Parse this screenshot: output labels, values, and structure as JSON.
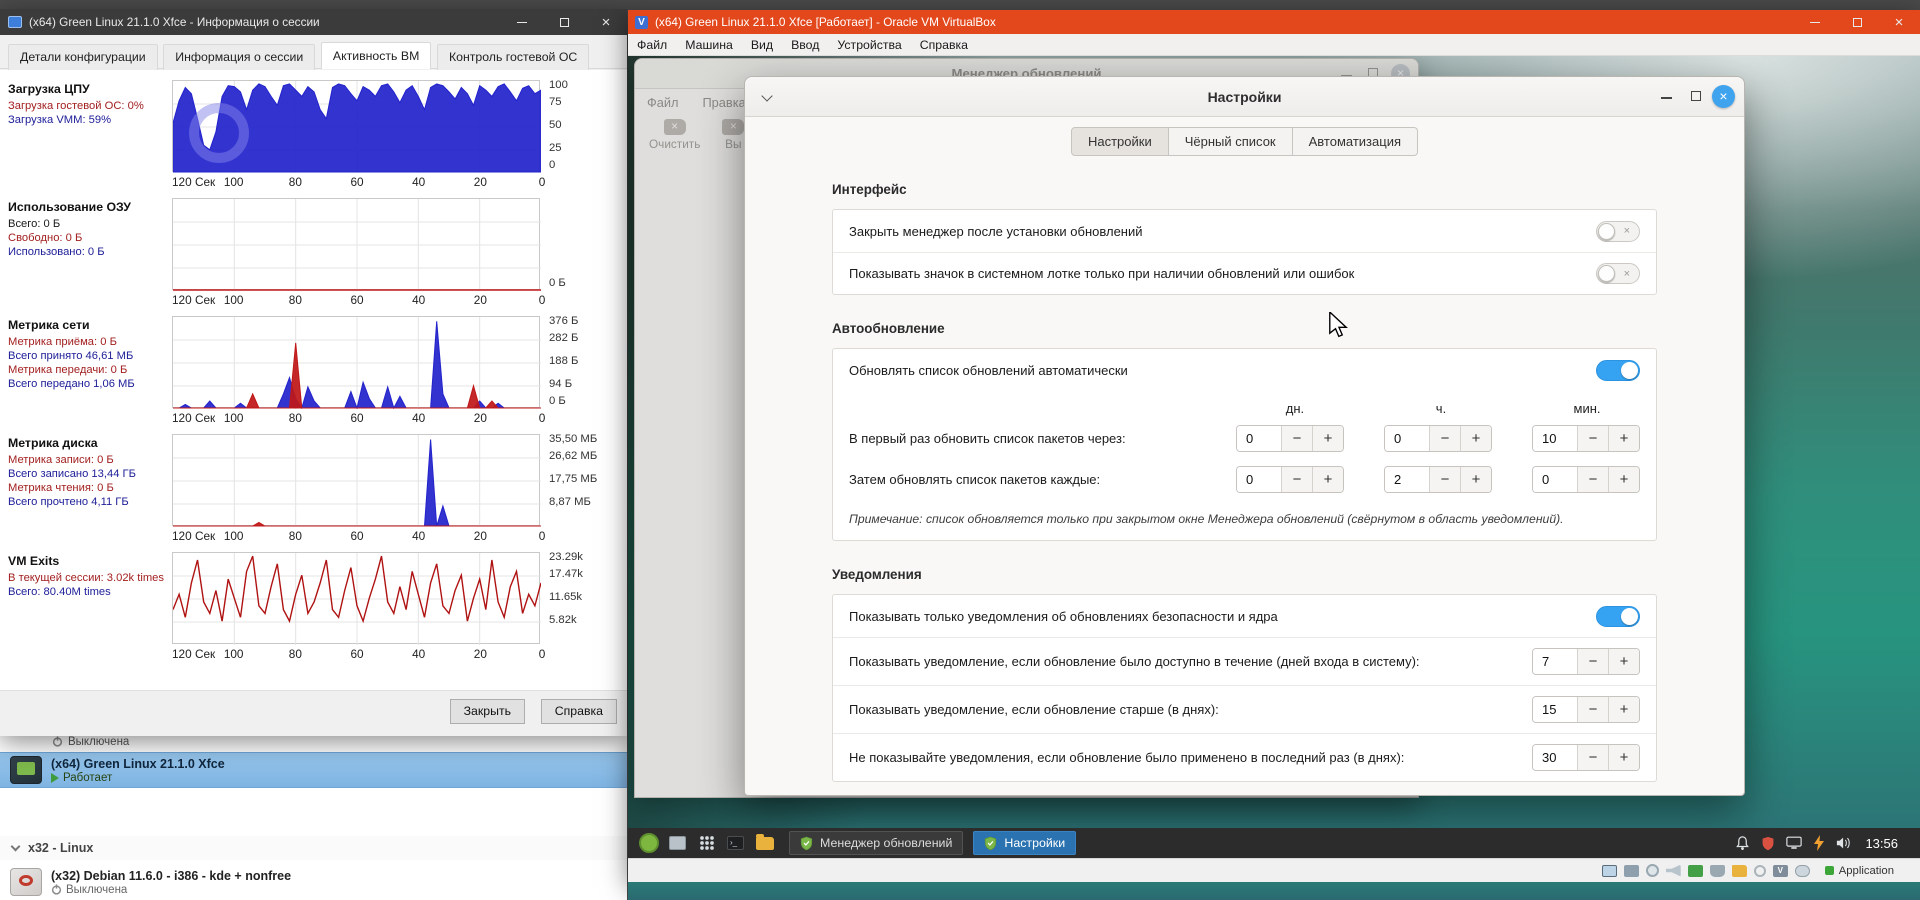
{
  "colors": {
    "accent_blue": "#36a3f2",
    "vbox_titlebar": "#e2481c",
    "panel_active_button": "#2a72b0",
    "list_selection": "#8abde8",
    "chart_blue": "#2323cc",
    "chart_red": "#c01818"
  },
  "host": {
    "session": {
      "title": "(x64) Green Linux 21.1.0 Xfce - Информация о сессии",
      "tabs": [
        "Детали конфигурации",
        "Информация о сессии",
        "Активность ВМ",
        "Контроль гостевой ОС"
      ],
      "active_tab": "Активность ВМ",
      "close_label": "Закрыть",
      "help_label": "Справка"
    },
    "list": {
      "partial_state": "Выключена",
      "selected": {
        "title": "(x64) Green Linux 21.1.0 Xfce",
        "state": "Работает"
      },
      "group_label": "x32 - Linux",
      "debian": {
        "title": "(x32) Debian 11.6.0 - i386 - kde + nonfree",
        "state": "Выключена"
      }
    }
  },
  "vbox": {
    "title": "(x64) Green Linux 21.1.0 Xfce [Работает] - Oracle VM VirtualBox",
    "menu": [
      "Файл",
      "Машина",
      "Вид",
      "Ввод",
      "Устройства",
      "Справка"
    ],
    "status": {
      "app_label": "Application"
    }
  },
  "mint": {
    "manager": {
      "title": "Менеджер обновлений",
      "menu": [
        "Файл",
        "Правка"
      ],
      "toolbar": {
        "clear": "Очистить",
        "partial": "Вы"
      }
    },
    "dialog": {
      "title": "Настройки",
      "tabs": [
        "Настройки",
        "Чёрный список",
        "Автоматизация"
      ],
      "interface": {
        "title": "Интерфейс",
        "rows": [
          "Закрыть менеджер после установки обновлений",
          "Показывать значок в системном лотке только при наличии обновлений или ошибок"
        ]
      },
      "auto": {
        "title": "Автообновление",
        "toggle_label": "Обновлять список обновлений автоматически",
        "col_headers": [
          "дн.",
          "ч.",
          "мин."
        ],
        "rows": [
          {
            "label": "В первый раз обновить список пакетов через:",
            "values": [
              "0",
              "0",
              "10"
            ]
          },
          {
            "label": "Затем обновлять список пакетов каждые:",
            "values": [
              "0",
              "2",
              "0"
            ]
          }
        ],
        "note": "Примечание: список обновляется только при закрытом окне Менеджера обновлений (свёрнутом в область уведомлений)."
      },
      "notifications": {
        "title": "Уведомления",
        "toggle_label": "Показывать только уведомления об обновлениях безопасности и ядра",
        "rows": [
          {
            "label": "Показывать уведомление, если обновление было доступно в течение (дней входа в систему):",
            "value": "7"
          },
          {
            "label": "Показывать уведомление, если обновление старше (в днях):",
            "value": "15"
          },
          {
            "label": "Не показывайте уведомления, если обновление было применено в последний раз (в днях):",
            "value": "30"
          }
        ]
      }
    },
    "panel": {
      "windows": [
        {
          "label": "Менеджер обновлений",
          "active": false
        },
        {
          "label": "Настройки",
          "active": true
        }
      ],
      "clock": "13:56"
    }
  },
  "chart_data": [
    {
      "id": "cpu",
      "type": "area",
      "title": "Загрузка ЦПУ",
      "ymax": 100,
      "watermark": true,
      "legend": [
        {
          "text": "Загрузка гостевой ОС: 0%",
          "color": "#a32020"
        },
        {
          "text": "Загрузка VMM: 59%",
          "color": "#20209a"
        }
      ],
      "ylabels": [
        {
          "t": "100",
          "f": 0
        },
        {
          "t": "75",
          "f": 0.25
        },
        {
          "t": "50",
          "f": 0.5
        },
        {
          "t": "25",
          "f": 0.75
        },
        {
          "t": "0",
          "f": 1
        }
      ],
      "xlabels": [
        "120 Сек",
        "100",
        "80",
        "60",
        "40",
        "20",
        "0"
      ],
      "series": [
        {
          "name": "Загрузка VMM",
          "color": "#2323cc",
          "fill": true,
          "values": [
            55,
            80,
            95,
            88,
            60,
            30,
            25,
            45,
            85,
            97,
            96,
            90,
            70,
            92,
            99,
            96,
            85,
            75,
            97,
            99,
            92,
            85,
            96,
            90,
            70,
            60,
            95,
            99,
            97,
            88,
            80,
            96,
            92,
            85,
            97,
            99,
            90,
            78,
            92,
            97,
            85,
            70,
            95,
            99,
            97,
            90,
            82,
            95,
            88,
            75,
            97,
            92,
            85,
            96,
            99,
            90,
            80,
            94,
            97,
            88,
            92
          ]
        }
      ]
    },
    {
      "id": "ram",
      "type": "line",
      "title": "Использование ОЗУ",
      "ymax": 100,
      "watermark": false,
      "legend": [
        {
          "text": "Всего: 0 Б",
          "color": "#1a1a1a"
        },
        {
          "text": "Свободно: 0 Б",
          "color": "#a32020"
        },
        {
          "text": "Использовано: 0 Б",
          "color": "#20209a"
        }
      ],
      "ylabels": [
        {
          "t": "0 Б",
          "f": 1
        }
      ],
      "xlabels": [
        "120 Сек",
        "100",
        "80",
        "60",
        "40",
        "20",
        "0"
      ],
      "series": [
        {
          "name": "Свободно",
          "color": "#c01818",
          "fill": false,
          "values": [
            0,
            0
          ]
        }
      ]
    },
    {
      "id": "net",
      "type": "line",
      "title": "Метрика сети",
      "ymax": 380,
      "watermark": false,
      "legend": [
        {
          "text": "Метрика приёма: 0 Б",
          "color": "#a32020"
        },
        {
          "text": "Всего принято 46,61 МБ",
          "color": "#20209a"
        },
        {
          "text": "Метрика передачи: 0 Б",
          "color": "#a32020"
        },
        {
          "text": "Всего передано 1,06 МБ",
          "color": "#20209a"
        }
      ],
      "ylabels": [
        {
          "t": "376 Б",
          "f": 0
        },
        {
          "t": "282 Б",
          "f": 0.25
        },
        {
          "t": "188 Б",
          "f": 0.5
        },
        {
          "t": "94 Б",
          "f": 0.75
        },
        {
          "t": "0 Б",
          "f": 1
        }
      ],
      "xlabels": [
        "120 Сек",
        "100",
        "80",
        "60",
        "40",
        "20",
        "0"
      ],
      "series": [
        {
          "name": "Приём",
          "color": "#2323cc",
          "fill": true,
          "values": [
            0,
            0,
            15,
            0,
            0,
            0,
            30,
            0,
            0,
            0,
            0,
            20,
            0,
            0,
            0,
            0,
            0,
            0,
            60,
            130,
            40,
            0,
            90,
            30,
            0,
            0,
            0,
            0,
            0,
            70,
            0,
            110,
            40,
            0,
            0,
            90,
            0,
            50,
            0,
            0,
            0,
            0,
            0,
            370,
            60,
            0,
            0,
            0,
            0,
            0,
            30,
            0,
            0,
            20,
            0,
            0,
            0,
            0,
            0,
            0,
            0
          ]
        },
        {
          "name": "Передача",
          "color": "#c01818",
          "fill": true,
          "values": [
            0,
            0,
            0,
            0,
            0,
            0,
            0,
            0,
            0,
            0,
            0,
            0,
            0,
            60,
            0,
            0,
            0,
            0,
            0,
            0,
            278,
            0,
            0,
            0,
            0,
            0,
            0,
            0,
            0,
            0,
            0,
            0,
            0,
            0,
            0,
            0,
            0,
            0,
            0,
            0,
            0,
            0,
            0,
            0,
            0,
            0,
            0,
            0,
            0,
            95,
            0,
            0,
            30,
            0,
            0,
            0,
            0,
            0,
            0,
            0,
            0
          ]
        }
      ]
    },
    {
      "id": "disk",
      "type": "line",
      "title": "Метрика диска",
      "ymax": 35.5,
      "watermark": false,
      "legend": [
        {
          "text": "Метрика записи: 0 Б",
          "color": "#a32020"
        },
        {
          "text": "Всего записано 13,44 ГБ",
          "color": "#20209a"
        },
        {
          "text": "Метрика чтения: 0 Б",
          "color": "#a32020"
        },
        {
          "text": "Всего прочтено 4,11 ГБ",
          "color": "#20209a"
        }
      ],
      "ylabels": [
        {
          "t": "35,50 МБ",
          "f": 0
        },
        {
          "t": "26,62 МБ",
          "f": 0.25
        },
        {
          "t": "17,75 МБ",
          "f": 0.5
        },
        {
          "t": "8,87 МБ",
          "f": 0.75
        }
      ],
      "xlabels": [
        "120 Сек",
        "100",
        "80",
        "60",
        "40",
        "20",
        "0"
      ],
      "series": [
        {
          "name": "Запись",
          "color": "#2323cc",
          "fill": true,
          "values": [
            0,
            0,
            0,
            0,
            0,
            0,
            0,
            0,
            0,
            0,
            0,
            0,
            0,
            0,
            0,
            0,
            0,
            0,
            0,
            0,
            0,
            0,
            0,
            0,
            0,
            0,
            0,
            0,
            0,
            0,
            0,
            0,
            0,
            0,
            0,
            0,
            0,
            0,
            0,
            0,
            0,
            0,
            34.5,
            0,
            8,
            0,
            0,
            0,
            0,
            0,
            0,
            0,
            0,
            0,
            0,
            0,
            0,
            0,
            0,
            0,
            0
          ]
        },
        {
          "name": "Чтение",
          "color": "#c01818",
          "fill": true,
          "values": [
            0,
            0,
            0,
            0,
            0,
            0,
            0,
            0,
            0,
            0,
            0,
            0,
            0,
            0,
            1.4,
            0,
            0,
            0,
            0,
            0,
            0,
            0,
            0,
            0,
            0,
            0,
            0,
            0,
            0,
            0,
            0,
            0,
            0,
            0,
            0,
            0,
            0,
            0,
            0,
            0,
            0,
            0,
            0,
            0,
            0,
            0,
            0,
            0,
            0,
            0,
            0,
            0,
            0,
            0,
            0,
            0,
            0,
            0,
            0,
            0,
            0
          ]
        }
      ]
    },
    {
      "id": "vmexits",
      "type": "line",
      "title": "VM Exits",
      "ymax": 23.3,
      "watermark": false,
      "legend": [
        {
          "text": "В текущей сессии: 3.02k times",
          "color": "#a32020"
        },
        {
          "text": "Всего: 80.40M times",
          "color": "#20209a"
        }
      ],
      "ylabels": [
        {
          "t": "23.29k",
          "f": 0
        },
        {
          "t": "17.47k",
          "f": 0.25
        },
        {
          "t": "11.65k",
          "f": 0.5
        },
        {
          "t": "5.82k",
          "f": 0.75
        }
      ],
      "xlabels": [
        "120 Сек",
        "100",
        "80",
        "60",
        "40",
        "20",
        "0"
      ],
      "series": [
        {
          "name": "VM Exits",
          "color": "#b01212",
          "fill": false,
          "values": [
            9,
            13,
            7,
            16,
            22,
            11,
            8,
            14,
            6,
            17,
            12,
            7,
            19,
            23,
            10,
            8,
            15,
            21,
            9,
            6,
            13,
            18,
            8,
            11,
            16,
            22,
            9,
            7,
            14,
            20,
            10,
            6,
            12,
            17,
            23,
            11,
            8,
            15,
            9,
            19,
            13,
            7,
            16,
            21,
            10,
            8,
            14,
            18,
            6,
            12,
            17,
            9,
            22,
            11,
            7,
            15,
            19,
            8,
            13,
            10,
            16
          ]
        }
      ]
    }
  ]
}
